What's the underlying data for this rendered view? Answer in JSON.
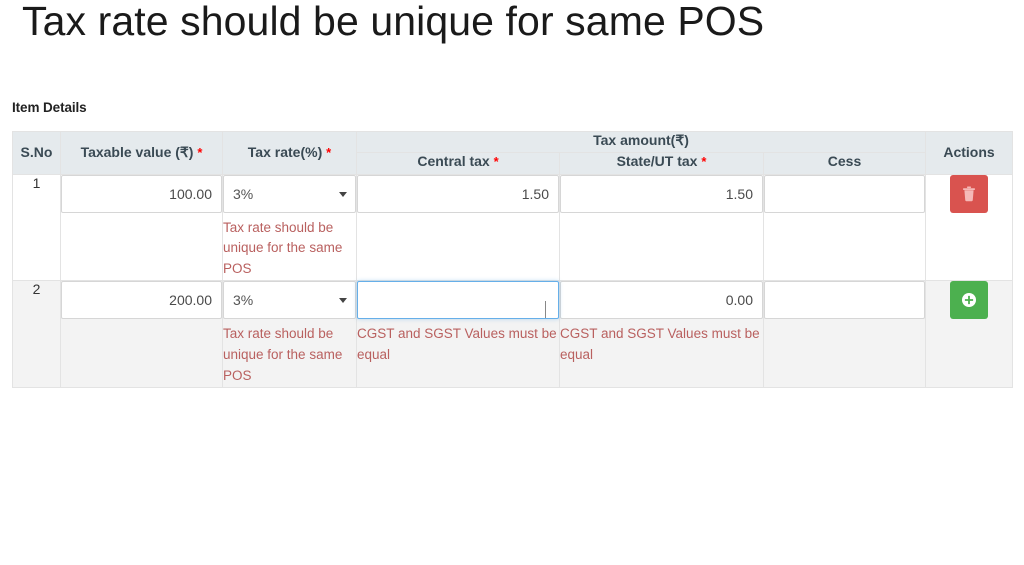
{
  "page": {
    "title": "Tax rate should be unique for same POS",
    "section_label": "Item Details"
  },
  "table": {
    "headers": {
      "sno": "S.No",
      "taxable_value": "Taxable value (₹)",
      "tax_rate": "Tax rate(%)",
      "tax_amount_group": "Tax amount(₹)",
      "central_tax": "Central tax",
      "state_ut_tax": "State/UT tax",
      "cess": "Cess",
      "actions": "Actions",
      "required_marker": "*"
    },
    "rows": [
      {
        "sno": "1",
        "taxable_value": "100.00",
        "tax_rate": "3%",
        "tax_rate_error": "Tax rate should be unique for the same POS",
        "central_tax": "1.50",
        "central_tax_error": "",
        "state_ut_tax": "1.50",
        "state_ut_tax_error": "",
        "cess": "",
        "action_icon": "trash-icon",
        "action_label": "Delete"
      },
      {
        "sno": "2",
        "taxable_value": "200.00",
        "tax_rate": "3%",
        "tax_rate_error": "Tax rate should be unique for the same POS",
        "central_tax": "",
        "central_tax_error": "CGST and SGST Values must be equal",
        "state_ut_tax": "0.00",
        "state_ut_tax_error": "CGST and SGST Values must be equal",
        "cess": "",
        "action_icon": "plus-circle-icon",
        "action_label": "Add"
      }
    ]
  },
  "colors": {
    "header_bg": "#e5eaed",
    "error_text": "#b9605f",
    "required_asterisk": "#ff0000",
    "delete_button": "#d9534f",
    "add_button": "#4cb04f",
    "focus_border": "#66afe9"
  }
}
